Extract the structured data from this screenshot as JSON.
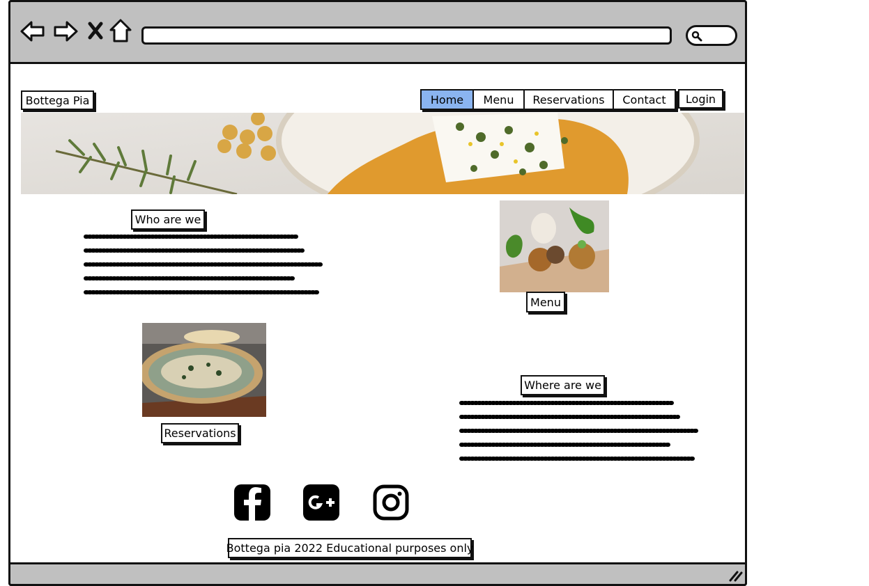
{
  "browser": {
    "url": "",
    "search": ""
  },
  "site": {
    "brand": "Bottega Pia",
    "login_label": "Login",
    "nav": [
      {
        "label": "Home",
        "active": true
      },
      {
        "label": "Menu",
        "active": false
      },
      {
        "label": "Reservations",
        "active": false
      },
      {
        "label": "Contact",
        "active": false
      }
    ]
  },
  "sections": {
    "who_title": "Who are we",
    "menu_label": "Menu",
    "reservations_label": "Reservations",
    "where_title": "Where are we"
  },
  "social": [
    {
      "icon": "facebook-icon"
    },
    {
      "icon": "google-plus-icon"
    },
    {
      "icon": "instagram-icon"
    }
  ],
  "footer": {
    "text": "Bottega pia 2022 Educational purposes only"
  },
  "colors": {
    "chrome": "#c0c0c0",
    "active_nav": "#8ab4f0"
  }
}
